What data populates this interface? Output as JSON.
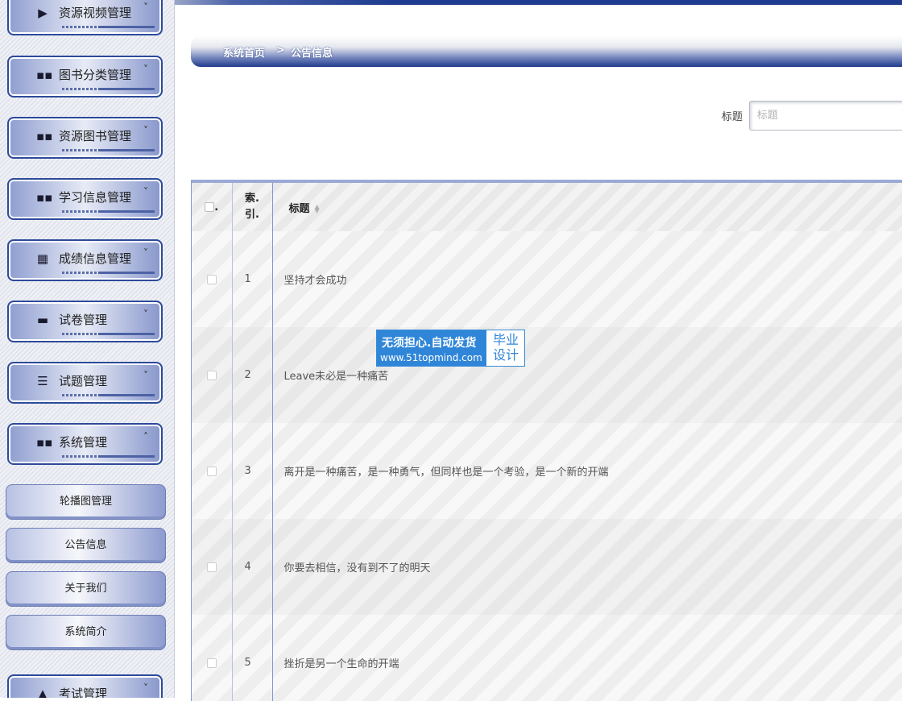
{
  "sidebar": {
    "menus": [
      {
        "label": "资源视频管理",
        "icon": "video-icon",
        "glyph": "▶",
        "expanded": false
      },
      {
        "label": "图书分类管理",
        "icon": "grid-icon",
        "glyph": "▪▪",
        "expanded": false
      },
      {
        "label": "资源图书管理",
        "icon": "grid-icon",
        "glyph": "▪▪",
        "expanded": false
      },
      {
        "label": "学习信息管理",
        "icon": "grid-icon",
        "glyph": "▪▪",
        "expanded": false
      },
      {
        "label": "成绩信息管理",
        "icon": "grid9-icon",
        "glyph": "▦",
        "expanded": false
      },
      {
        "label": "试卷管理",
        "icon": "monitor-icon",
        "glyph": "▬",
        "expanded": false
      },
      {
        "label": "试题管理",
        "icon": "sliders-icon",
        "glyph": "☰",
        "expanded": false
      },
      {
        "label": "系统管理",
        "icon": "grid-icon",
        "glyph": "▪▪",
        "expanded": true
      },
      {
        "label": "考试管理",
        "icon": "exam-icon",
        "glyph": "▲",
        "expanded": false
      }
    ],
    "submenu": [
      "轮播图管理",
      "公告信息",
      "关于我们",
      "系统简介"
    ],
    "chevron_down": "˅",
    "chevron_up": "˄"
  },
  "breadcrumb": {
    "home": "系统首页",
    "separator": ">",
    "current": "公告信息"
  },
  "search": {
    "label": "标题",
    "placeholder": "标题",
    "value": ""
  },
  "table": {
    "headers": {
      "check": ".",
      "index": "索.\n引.",
      "title": "标题"
    },
    "rows": [
      {
        "index": "1",
        "title": "坚持才会成功"
      },
      {
        "index": "2",
        "title": "Leave未必是一种痛苦"
      },
      {
        "index": "3",
        "title": "离开是一种痛苦，是一种勇气，但同样也是一个考验，是一个新的开端"
      },
      {
        "index": "4",
        "title": "你要去相信，没有到不了的明天"
      },
      {
        "index": "5",
        "title": "挫折是另一个生命的开端"
      }
    ]
  },
  "watermark": {
    "line1": "无须担心.自动发货",
    "line2": "www.51topmind.com",
    "right": "毕业\n设计"
  },
  "colors": {
    "accent": "#1e3b8f",
    "menu_border": "#2d4a9a",
    "watermark": "#2f86d8"
  }
}
